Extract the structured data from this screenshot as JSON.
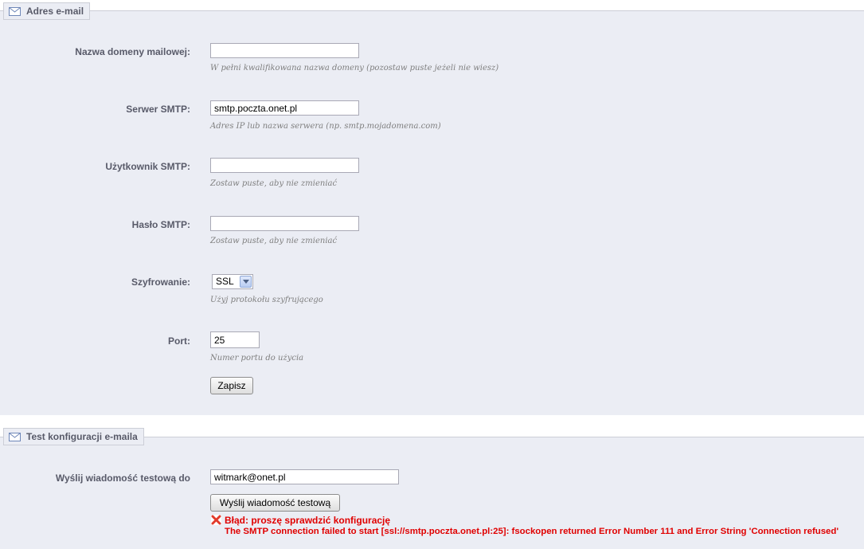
{
  "email_section": {
    "legend": "Adres e-mail",
    "icon": "envelope-icon",
    "domain": {
      "label": "Nazwa domeny mailowej:",
      "value": "",
      "hint": "W pełni kwalifikowana nazwa domeny (pozostaw puste jeżeli nie wiesz)"
    },
    "smtp_server": {
      "label": "Serwer SMTP:",
      "value": "smtp.poczta.onet.pl",
      "hint": "Adres IP lub nazwa serwera (np. smtp.mojadomena.com)"
    },
    "smtp_user": {
      "label": "Użytkownik SMTP:",
      "value": "",
      "hint": "Zostaw puste, aby nie zmieniać"
    },
    "smtp_password": {
      "label": "Hasło SMTP:",
      "value": "",
      "hint": "Zostaw puste, aby nie zmieniać"
    },
    "encryption": {
      "label": "Szyfrowanie:",
      "value": "SSL",
      "hint": "Użyj protokołu szyfrującego"
    },
    "port": {
      "label": "Port:",
      "value": "25",
      "hint": "Numer portu do użycia"
    },
    "save_label": "Zapisz"
  },
  "test_section": {
    "legend": "Test konfiguracji e-maila",
    "icon": "envelope-icon",
    "recipient": {
      "label": "Wyślij wiadomość testową do",
      "value": "witmark@onet.pl"
    },
    "send_label": "Wyślij wiadomość testową",
    "error": {
      "icon": "error-x-icon",
      "title": "Błąd: proszę sprawdzić konfigurację",
      "detail": "The SMTP connection failed to start [ssl://smtp.poczta.onet.pl:25]: fsockopen returned Error Number 111 and Error String 'Connection refused'"
    }
  },
  "colors": {
    "panel_bg": "#ebedf4",
    "label": "#585a69",
    "hint": "#7f7f7f",
    "error": "#e00000"
  }
}
